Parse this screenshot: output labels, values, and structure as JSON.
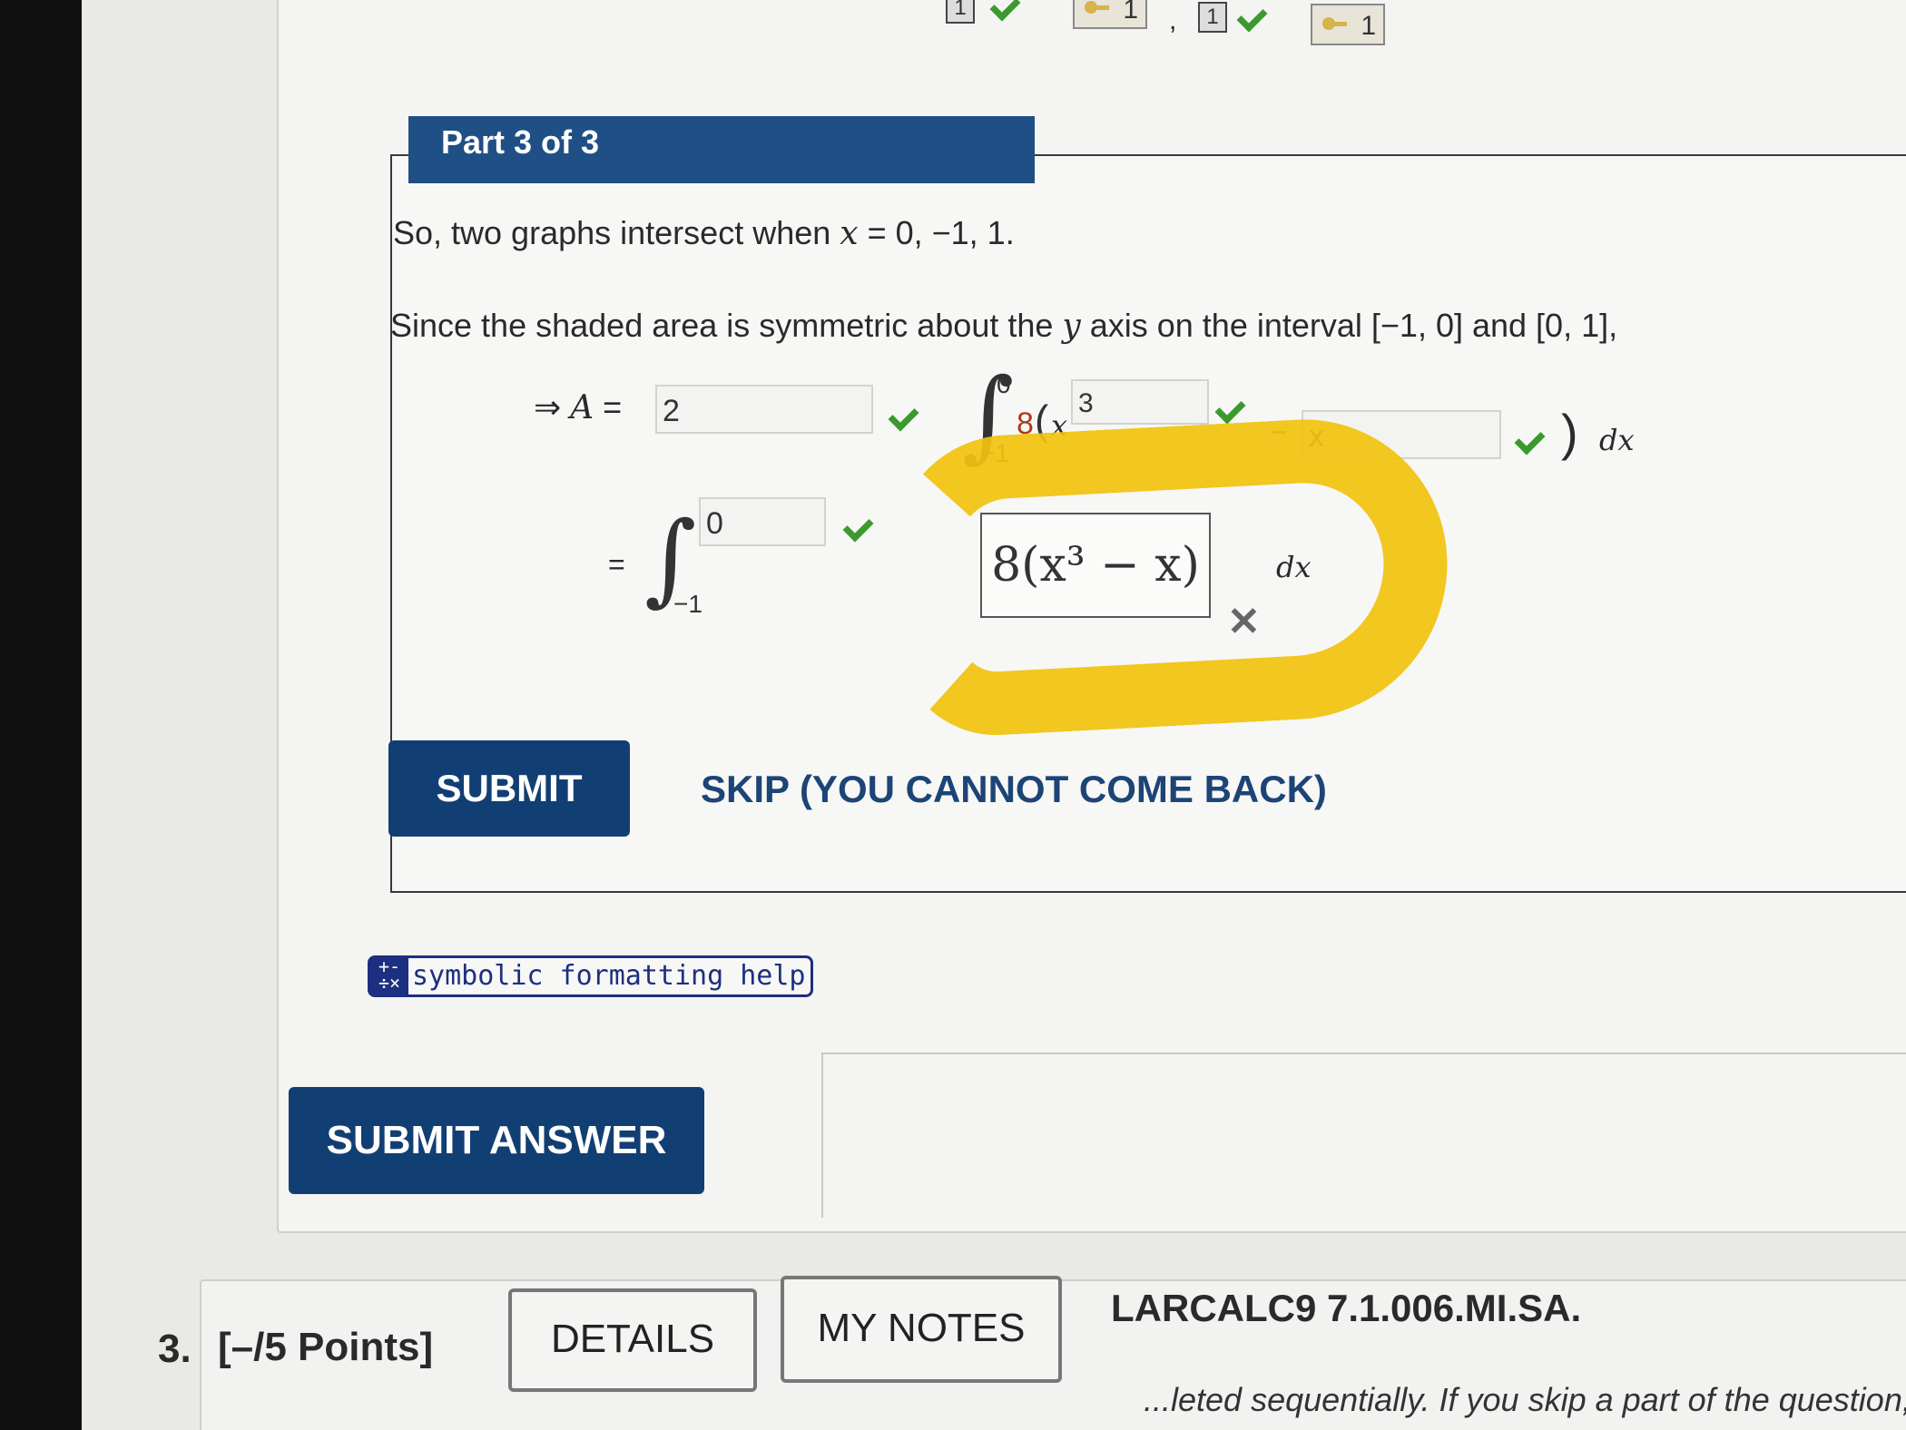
{
  "score_strip": {
    "items": [
      "1",
      "1",
      "1",
      "1"
    ]
  },
  "part": {
    "header": "Part 3 of 3",
    "line1_prefix": "So, two graphs intersect when ",
    "line1_var": "x",
    "line1_suffix": " = 0, −1, 1.",
    "line2_prefix": "Since the shaded area is symmetric about the ",
    "line2_var": "y",
    "line2_suffix": " axis on the interval [−1, 0] and [0, 1],",
    "eq1_prefix": "⇒ ",
    "eq1_var": "A",
    "eq1_equals": " = ",
    "eq1_field_value": "2",
    "integral_upper": "0",
    "integral_lower": "−1",
    "integrand_coeff": "8",
    "integrand_paren": "(",
    "integrand_var": "x",
    "field_exponent_value": "3",
    "minus_sign": "−",
    "field_x_value": "x",
    "close_paren": ")",
    "dx": "dx",
    "eq2_equals": "=",
    "eq2_upper_value": "0",
    "eq2_lower": "−1",
    "eq2_answer": "8(x³ − x)",
    "eq2_dx": "dx",
    "submit": "SUBMIT",
    "skip": "SKIP (YOU CANNOT COME BACK)"
  },
  "help": {
    "icon_glyph": "+-÷×",
    "label": "symbolic formatting help"
  },
  "submit_answer": "SUBMIT ANSWER",
  "next_question": {
    "number": "3.",
    "points": "[–/5 Points]",
    "details": "DETAILS",
    "my_notes": "MY NOTES",
    "code": "LARCALC9 7.1.006.MI.SA.",
    "note_text": "...leted sequentially. If you skip a part of the question, y"
  }
}
